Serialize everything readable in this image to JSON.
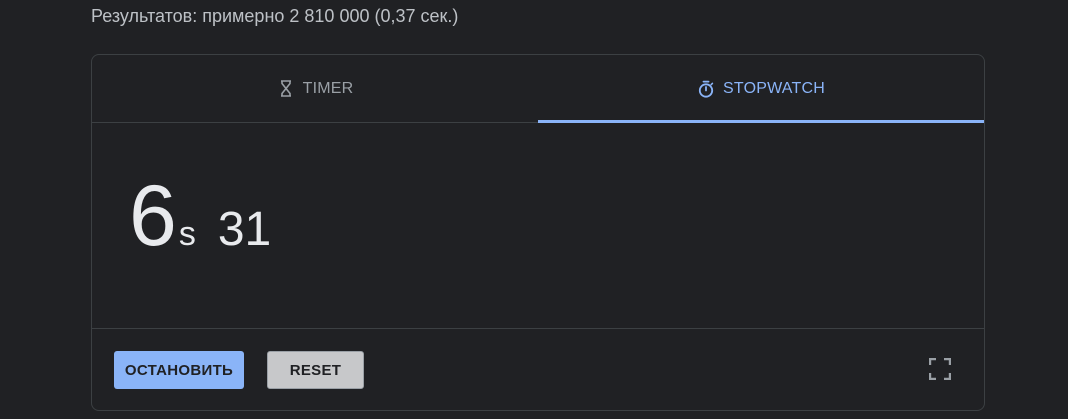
{
  "results_stats": "Результатов: примерно 2 810 000 (0,37 сек.)",
  "tabs": [
    {
      "label": "TIMER",
      "icon": "hourglass-icon",
      "active": false
    },
    {
      "label": "STOPWATCH",
      "icon": "stopwatch-icon",
      "active": true
    }
  ],
  "stopwatch": {
    "seconds": "6",
    "seconds_unit": "s",
    "hundredths": "31"
  },
  "buttons": {
    "stop_label": "ОСТАНОВИТЬ",
    "reset_label": "RESET"
  },
  "fullscreen_icon": "fullscreen-icon",
  "colors": {
    "accent": "#8ab4f8",
    "background": "#202124",
    "text": "#e8eaed",
    "muted": "#9aa0a6",
    "divider": "#3c4043"
  }
}
